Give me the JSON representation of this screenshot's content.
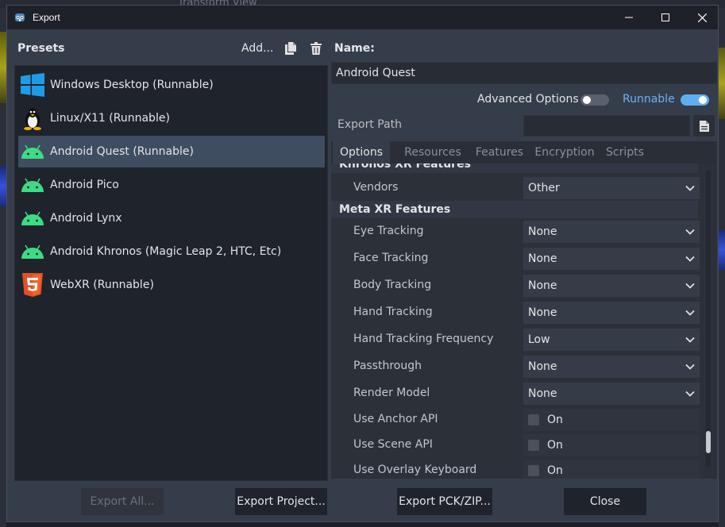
{
  "background": {
    "menu_text": "Transform    View"
  },
  "window": {
    "title": "Export",
    "controls": [
      "minimize",
      "maximize",
      "close"
    ]
  },
  "presets": {
    "label": "Presets",
    "add_label": "Add...",
    "items": [
      {
        "label": "Windows Desktop (Runnable)",
        "icon": "windows-icon",
        "selected": false
      },
      {
        "label": "Linux/X11 (Runnable)",
        "icon": "linux-icon",
        "selected": false
      },
      {
        "label": "Android Quest (Runnable)",
        "icon": "android-icon",
        "selected": true
      },
      {
        "label": "Android Pico",
        "icon": "android-icon",
        "selected": false
      },
      {
        "label": "Android Lynx",
        "icon": "android-icon",
        "selected": false
      },
      {
        "label": "Android Khronos (Magic Leap 2, HTC, Etc)",
        "icon": "android-icon",
        "selected": false
      },
      {
        "label": "WebXR (Runnable)",
        "icon": "html5-icon",
        "selected": false
      }
    ]
  },
  "details": {
    "name_label": "Name:",
    "name_value": "Android Quest",
    "advanced_options_label": "Advanced Options",
    "advanced_options_on": false,
    "runnable_label": "Runnable",
    "runnable_on": true,
    "export_path_label": "Export Path",
    "export_path_value": "",
    "tabs": [
      "Options",
      "Resources",
      "Features",
      "Encryption",
      "Scripts"
    ],
    "active_tab": "Options"
  },
  "options": {
    "khronos_header": "Khronos XR Features",
    "vendors": {
      "label": "Vendors",
      "value": "Other"
    },
    "meta_header": "Meta XR Features",
    "meta_rows": [
      {
        "label": "Eye Tracking",
        "value": "None"
      },
      {
        "label": "Face Tracking",
        "value": "None"
      },
      {
        "label": "Body Tracking",
        "value": "None"
      },
      {
        "label": "Hand Tracking",
        "value": "None"
      },
      {
        "label": "Hand Tracking Frequency",
        "value": "Low"
      },
      {
        "label": "Passthrough",
        "value": "None"
      },
      {
        "label": "Render Model",
        "value": "None"
      }
    ],
    "check_rows": [
      {
        "label": "Use Anchor API",
        "value": "On"
      },
      {
        "label": "Use Scene API",
        "value": "On"
      },
      {
        "label": "Use Overlay Keyboard",
        "value": "On"
      }
    ]
  },
  "footer": {
    "export_all": "Export All...",
    "export_project": "Export Project...",
    "export_pck": "Export PCK/ZIP...",
    "close": "Close"
  },
  "colors": {
    "accent": "#69b4f5",
    "selected_row": "#3e4d60",
    "android_green": "#3ddc84",
    "windows_blue": "#1e9be8",
    "html5_orange": "#e34f26"
  }
}
